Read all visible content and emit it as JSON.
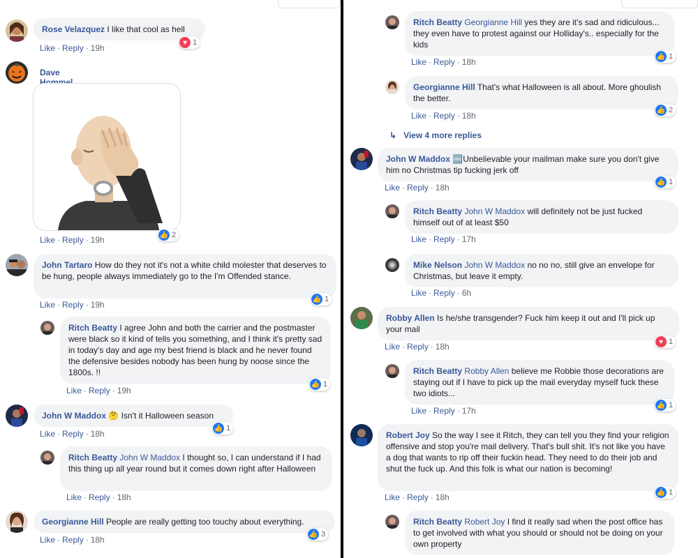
{
  "left": {
    "c1": {
      "author": "Rose Velazquez",
      "text": "I like that cool as hell",
      "like": "Like",
      "reply": "Reply",
      "time": "19h",
      "reaction_count": "1",
      "reaction": "love"
    },
    "c2": {
      "author": "Dave Hommel",
      "sticker": "facepalm-emoji",
      "like": "Like",
      "reply": "Reply",
      "time": "19h",
      "reaction_count": "2",
      "reaction": "like"
    },
    "c3": {
      "author": "John Tartaro",
      "text": "How do they not it's not a white child molester that deserves to be hung, people always immediately go to the I'm Offended stance.",
      "like": "Like",
      "reply": "Reply",
      "time": "19h",
      "reaction_count": "1"
    },
    "c3r1": {
      "author": "Ritch Beatty",
      "text": "I agree John and both the carrier and the postmaster were black so it kind of tells you something, and I think it's pretty sad in today's day and age my best friend is black and he never found the defensive besides nobody has been hung by noose since the 1800s. !!",
      "like": "Like",
      "reply": "Reply",
      "time": "19h",
      "reaction_count": "1"
    },
    "c4": {
      "author": "John W Maddox",
      "emoji": "🤔",
      "text": "Isn't it Halloween season",
      "like": "Like",
      "reply": "Reply",
      "time": "18h",
      "reaction_count": "1"
    },
    "c4r1": {
      "author": "Ritch Beatty",
      "mention": "John W Maddox",
      "text": "I thought so, I can understand if I had this thing up all year round but it comes down right after Halloween",
      "like": "Like",
      "reply": "Reply",
      "time": "18h"
    },
    "c5": {
      "author": "Georgianne Hill",
      "text": "People are really getting too touchy about everything.",
      "like": "Like",
      "reply": "Reply",
      "time": "18h",
      "reaction_count": "3"
    }
  },
  "right": {
    "r1": {
      "author": "Ritch Beatty",
      "mention": "Georgianne Hill",
      "text": "yes they are it's sad and ridiculous... they even have to protest against our Holliday's.. especially for the kids",
      "like": "Like",
      "reply": "Reply",
      "time": "18h",
      "reaction_count": "1"
    },
    "r2": {
      "author": "Georgianne Hill",
      "text": "That's what Halloween is all about. More ghoulish the better.",
      "like": "Like",
      "reply": "Reply",
      "time": "18h",
      "reaction_count": "2"
    },
    "view_more": "View 4 more replies",
    "r3": {
      "author": "John W Maddox",
      "text": "🆒Unbelievable your mailman make sure you don't give him no Christmas tip fucking jerk off",
      "like": "Like",
      "reply": "Reply",
      "time": "18h",
      "reaction_count": "1"
    },
    "r4": {
      "author": "Ritch Beatty",
      "mention": "John W Maddox",
      "text": "will definitely not be just fucked himself out of at least $50",
      "like": "Like",
      "reply": "Reply",
      "time": "17h"
    },
    "r5": {
      "author": "Mike Nelson",
      "mention": "John W Maddox",
      "text": "no no no, still give an envelope for Christmas, but leave it empty.",
      "like": "Like",
      "reply": "Reply",
      "time": "6h"
    },
    "r6": {
      "author": "Robby Allen",
      "text": "Is he/she transgender? Fuck him keep it out and I'll pick up your mail",
      "like": "Like",
      "reply": "Reply",
      "time": "18h",
      "reaction_count": "1",
      "reaction": "love"
    },
    "r7": {
      "author": "Ritch Beatty",
      "mention": "Robby Allen",
      "text": "believe me Robbie those decorations are staying out if I have to pick up the mail everyday myself fuck these two idiots...",
      "like": "Like",
      "reply": "Reply",
      "time": "17h",
      "reaction_count": "1"
    },
    "r8": {
      "author": "Robert Joy",
      "text": "So the way I see it Ritch, they can tell you they find your religion offensive and stop you're mail delivery. That's bull shit. It's not like you have a dog that wants to rip off their fuckin head. They need to do their job and shut the fuck up. And this folk is what our nation is becoming!",
      "like": "Like",
      "reply": "Reply",
      "time": "18h",
      "reaction_count": "1"
    },
    "r9": {
      "author": "Ritch Beatty",
      "mention": "Robert Joy",
      "text": "I find it really sad when the post office has to get involved with what you should or should not be doing on your own property"
    }
  },
  "colors": {
    "link": "#385898",
    "bubble": "#f2f3f5",
    "meta": "#606770",
    "like_badge": "#2078f4",
    "love_badge": "#f33e58"
  }
}
